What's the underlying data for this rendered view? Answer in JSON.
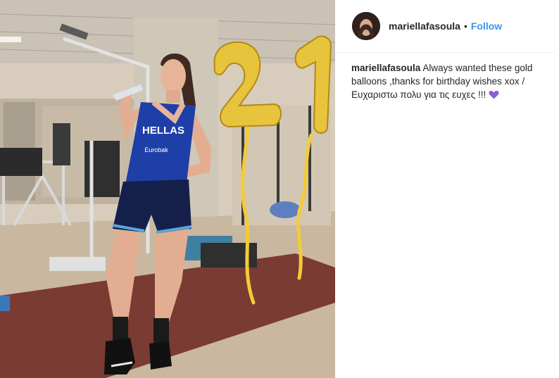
{
  "post": {
    "username": "mariellafasoula",
    "follow_label": "Follow",
    "separator": "•",
    "caption_text": "Always wanted these gold balloons ,thanks for birthday wishes xox / Ευχαριστω πολυ για τις ευχες !!!",
    "caption_emoji": "purple-heart",
    "jersey_text": "HELLAS",
    "jersey_sponsor": "Eurobak",
    "balloon_digits": "21"
  },
  "colors": {
    "follow": "#3897f0",
    "text": "#262626",
    "jersey": "#1f3fa8",
    "balloon_gold": "#e8c33c",
    "heart": "#8d5cd6"
  }
}
